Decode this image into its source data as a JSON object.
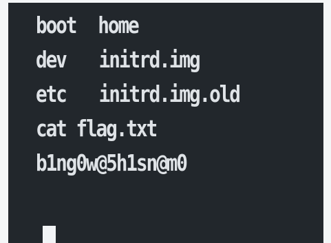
{
  "terminal": {
    "lines": [
      [
        "boot",
        "home"
      ],
      [
        "dev",
        "initrd.img"
      ],
      [
        "etc",
        "initrd.img.old"
      ],
      [
        "cat flag.txt",
        ""
      ],
      [
        "b1ng0w@5h1sn@m0",
        ""
      ]
    ]
  },
  "colors": {
    "background": "#22272c",
    "text": "#dfe3e7",
    "cursor": "#f2f4f6",
    "frame": "#f4f6f7"
  }
}
